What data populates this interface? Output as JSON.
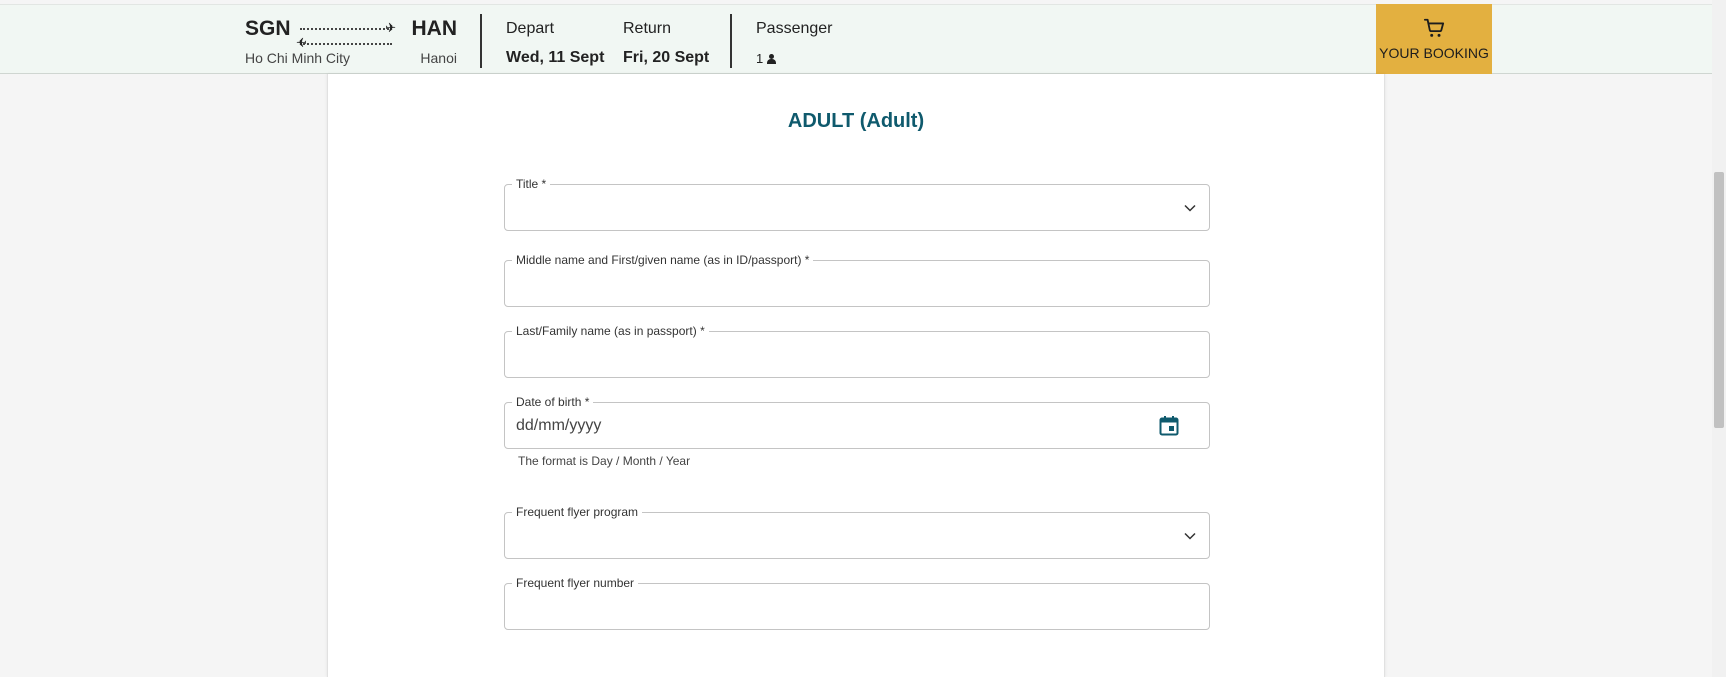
{
  "header": {
    "origin_code": "SGN",
    "origin_city": "Ho Chi Minh City",
    "destination_code": "HAN",
    "destination_city": "Hanoi",
    "depart_label": "Depart",
    "depart_value": "Wed, 11 Sept",
    "return_label": "Return",
    "return_value": "Fri, 20 Sept",
    "passenger_label": "Passenger",
    "passenger_count": "1",
    "booking_label": "YOUR BOOKING"
  },
  "form": {
    "title": "ADULT (Adult)",
    "fields": {
      "title_label": "Title *",
      "given_label": "Middle name and First/given name (as in ID/passport) *",
      "last_label": "Last/Family name (as in passport) *",
      "dob_label": "Date of birth *",
      "dob_placeholder": "dd/mm/yyyy",
      "dob_helper": "The format is Day / Month / Year",
      "ffp_label": "Frequent flyer program",
      "ffn_label": "Frequent flyer number"
    }
  },
  "colors": {
    "header_bg": "#f1f7f3",
    "accent_gold": "#e3b040",
    "title_teal": "#0f5a6d"
  },
  "icons": [
    "plane-icon",
    "person-icon",
    "cart-icon",
    "chevron-down-icon",
    "calendar-icon"
  ]
}
